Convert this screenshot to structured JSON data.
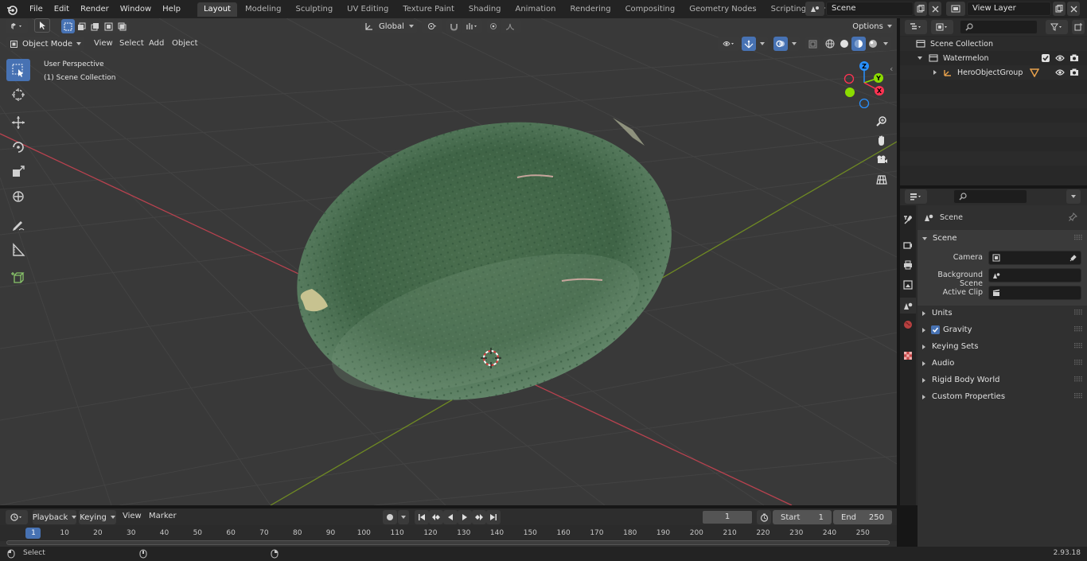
{
  "topbar": {
    "menus": [
      "File",
      "Edit",
      "Render",
      "Window",
      "Help"
    ],
    "workspaces": [
      "Layout",
      "Modeling",
      "Sculpting",
      "UV Editing",
      "Texture Paint",
      "Shading",
      "Animation",
      "Rendering",
      "Compositing",
      "Geometry Nodes",
      "Scripting"
    ],
    "active_workspace": "Layout",
    "scene_name": "Scene",
    "view_layer": "View Layer"
  },
  "viewport": {
    "mode": "Object Mode",
    "menus": [
      "View",
      "Select",
      "Add",
      "Object"
    ],
    "transform_orientation": "Global",
    "options_label": "Options",
    "overlay_title": "User Perspective",
    "overlay_collection": "(1) Scene Collection",
    "gizmo": {
      "z": "Z",
      "y": "Y",
      "x": "X"
    }
  },
  "outliner": {
    "root": "Scene Collection",
    "rows": [
      {
        "name": "Watermelon"
      },
      {
        "name": "HeroObjectGroup"
      }
    ]
  },
  "properties": {
    "context_title": "Scene",
    "panel_title": "Scene",
    "fields": [
      {
        "label": "Camera",
        "value": ""
      },
      {
        "label": "Background Scene",
        "value": ""
      },
      {
        "label": "Active Clip",
        "value": ""
      }
    ],
    "sections": [
      "Units",
      "Gravity",
      "Keying Sets",
      "Audio",
      "Rigid Body World",
      "Custom Properties"
    ],
    "gravity_checked": true
  },
  "timeline": {
    "menus": [
      "Playback",
      "Keying",
      "View",
      "Marker"
    ],
    "current_frame": "1",
    "start_label": "Start",
    "start_value": "1",
    "end_label": "End",
    "end_value": "250",
    "ruler": [
      "1",
      "10",
      "20",
      "30",
      "40",
      "50",
      "60",
      "70",
      "80",
      "90",
      "100",
      "110",
      "120",
      "130",
      "140",
      "150",
      "160",
      "170",
      "180",
      "190",
      "200",
      "210",
      "220",
      "230",
      "240",
      "250"
    ]
  },
  "statusbar": {
    "left_hint": "Select",
    "version": "2.93.18"
  },
  "colors": {
    "accent": "#4772b3",
    "x_axis": "#ff3352",
    "y_axis": "#8bdc00",
    "z_axis": "#2890ff"
  }
}
